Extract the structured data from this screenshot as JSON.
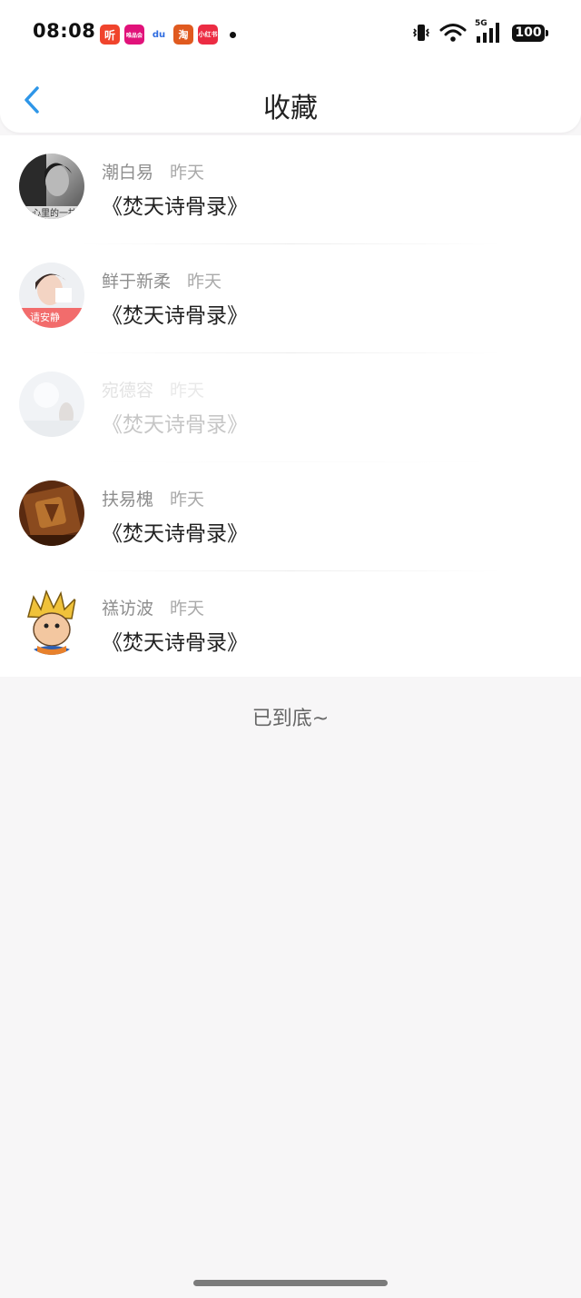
{
  "status_bar": {
    "time": "08:08",
    "apps": [
      {
        "name": "ting-app-icon",
        "label": "听",
        "color": "#f0442c"
      },
      {
        "name": "weishi-app-icon",
        "label": "唯品会",
        "color": "#e1127a"
      },
      {
        "name": "baidu-app-icon",
        "label": "du",
        "color": "#2f6ce0"
      },
      {
        "name": "taobao-app-icon",
        "label": "淘",
        "color": "#e05a1f"
      },
      {
        "name": "xiaohongshu-app-icon",
        "label": "小红书",
        "color": "#ec2c43"
      }
    ],
    "network": "5G",
    "battery": "100"
  },
  "header": {
    "title": "收藏"
  },
  "favorites": [
    {
      "name": "潮白易",
      "time": "昨天",
      "book": "《焚天诗骨录》",
      "faded": false,
      "avatar": "grayscale-portrait"
    },
    {
      "name": "鲜于新柔",
      "time": "昨天",
      "book": "《焚天诗骨录》",
      "faded": false,
      "avatar": "girl-with-pink-banner",
      "avatar_text": "请安静"
    },
    {
      "name": "宛德容",
      "time": "昨天",
      "book": "《焚天诗骨录》",
      "faded": true,
      "avatar": "misty-figure"
    },
    {
      "name": "扶易槐",
      "time": "昨天",
      "book": "《焚天诗骨录》",
      "faded": false,
      "avatar": "bronze-emblem"
    },
    {
      "name": "禚访波",
      "time": "昨天",
      "book": "《焚天诗骨录》",
      "faded": false,
      "avatar": "cartoon-spiky-hair"
    }
  ],
  "footer": {
    "end_text": "已到底~"
  },
  "colors": {
    "accent": "#2e96e8",
    "background": "#f7f6f7"
  }
}
